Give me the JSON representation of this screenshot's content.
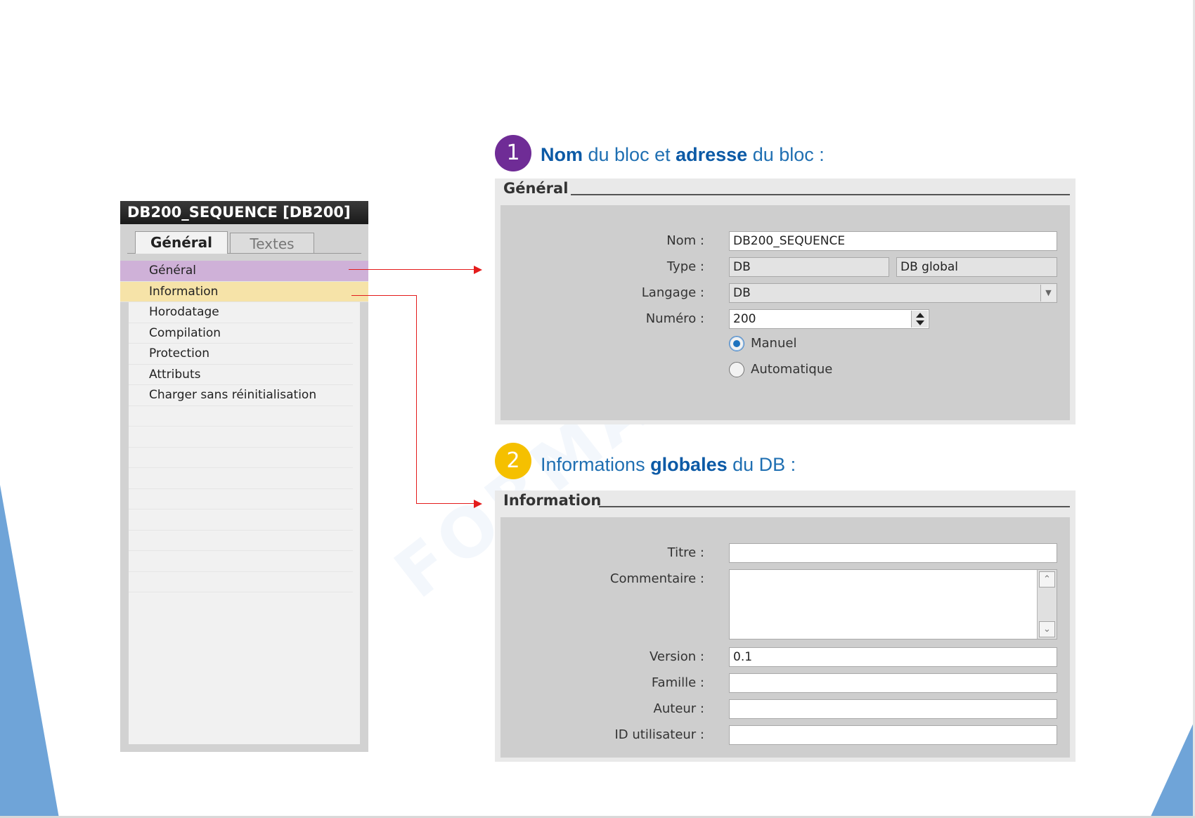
{
  "watermark": "FORMA",
  "nav": {
    "title": "DB200_SEQUENCE [DB200]",
    "tabs": [
      "Général",
      "Textes"
    ],
    "items": [
      "Général",
      "Information",
      "Horodatage",
      "Compilation",
      "Protection",
      "Attributs",
      "Charger sans réinitialisation"
    ]
  },
  "section1": {
    "number": "1",
    "heading": {
      "part1": "Nom",
      "part2": " du bloc et ",
      "part3": "adresse",
      "part4": " du bloc :"
    },
    "panel_title": "Général",
    "labels": {
      "nom": "Nom :",
      "type": "Type :",
      "langage": "Langage :",
      "numero": "Numéro :"
    },
    "values": {
      "nom": "DB200_SEQUENCE",
      "type": "DB",
      "type2": "DB global",
      "langage": "DB",
      "numero": "200"
    },
    "radio": {
      "manual": "Manuel",
      "auto": "Automatique",
      "selected": "Manuel"
    }
  },
  "section2": {
    "number": "2",
    "heading": {
      "part1": "Informations ",
      "part2": "globales",
      "part3": " du DB :"
    },
    "panel_title": "Information",
    "labels": {
      "titre": "Titre :",
      "commentaire": "Commentaire :",
      "version": "Version :",
      "famille": "Famille :",
      "auteur": "Auteur :",
      "id": "ID utilisateur :"
    },
    "values": {
      "titre": "",
      "commentaire": "",
      "version": "0.1",
      "famille": "",
      "auteur": "",
      "id": ""
    }
  },
  "colors": {
    "badge1": "#6f2c96",
    "badge2": "#f5c000",
    "heading": "#1f6fb2",
    "connector": "#e41c1c",
    "sel_purple": "#cfb1d8",
    "sel_yellow": "#f6e3a8",
    "accent": "#6fa4d8"
  }
}
